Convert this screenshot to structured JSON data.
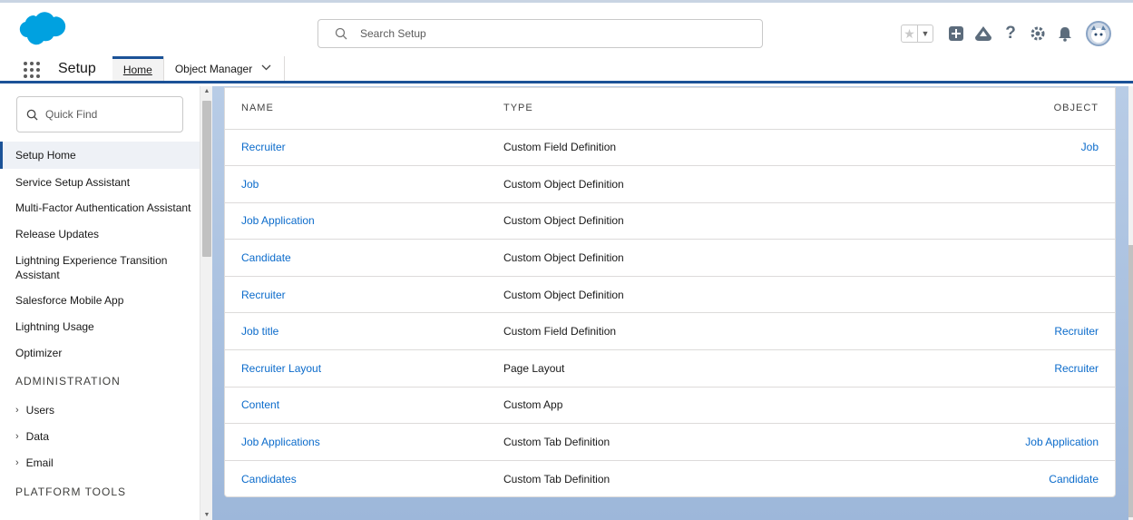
{
  "header": {
    "search_placeholder": "Search Setup"
  },
  "context": {
    "app_name": "Setup",
    "tabs": [
      {
        "label": "Home"
      },
      {
        "label": "Object Manager"
      }
    ]
  },
  "sidebar": {
    "quickfind_placeholder": "Quick Find",
    "items": [
      {
        "label": "Setup Home"
      },
      {
        "label": "Service Setup Assistant"
      },
      {
        "label": "Multi-Factor Authentication Assistant"
      },
      {
        "label": "Release Updates"
      },
      {
        "label": "Lightning Experience Transition Assistant"
      },
      {
        "label": "Salesforce Mobile App"
      },
      {
        "label": "Lightning Usage"
      },
      {
        "label": "Optimizer"
      }
    ],
    "section_administration": "ADMINISTRATION",
    "admin_items": [
      {
        "label": "Users"
      },
      {
        "label": "Data"
      },
      {
        "label": "Email"
      }
    ],
    "section_platform": "PLATFORM TOOLS"
  },
  "results": {
    "columns": [
      "NAME",
      "TYPE",
      "OBJECT"
    ],
    "rows": [
      {
        "name": "Recruiter",
        "type": "Custom Field Definition",
        "object": "Job"
      },
      {
        "name": "Job",
        "type": "Custom Object Definition",
        "object": ""
      },
      {
        "name": "Job Application",
        "type": "Custom Object Definition",
        "object": ""
      },
      {
        "name": "Candidate",
        "type": "Custom Object Definition",
        "object": ""
      },
      {
        "name": "Recruiter",
        "type": "Custom Object Definition",
        "object": ""
      },
      {
        "name": "Job title",
        "type": "Custom Field Definition",
        "object": "Recruiter"
      },
      {
        "name": "Recruiter Layout",
        "type": "Page Layout",
        "object": "Recruiter"
      },
      {
        "name": "Content",
        "type": "Custom App",
        "object": ""
      },
      {
        "name": "Job Applications",
        "type": "Custom Tab Definition",
        "object": "Job Application"
      },
      {
        "name": "Candidates",
        "type": "Custom Tab Definition",
        "object": "Candidate"
      }
    ]
  },
  "colors": {
    "brand": "#1b5297",
    "link": "#0b6bcb",
    "cloud": "#00a1e0"
  }
}
